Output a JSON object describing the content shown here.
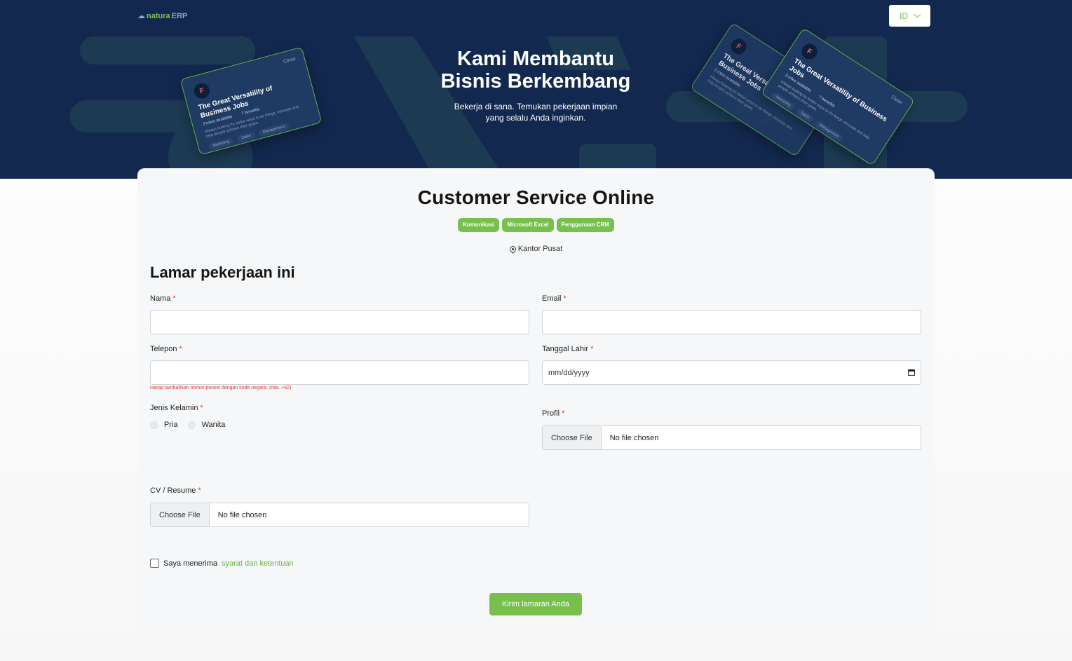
{
  "header": {
    "logo_brand": "natura",
    "logo_suffix": "ERP",
    "language": "ID",
    "title_line1": "Kami Membantu",
    "title_line2": "Bisnis Berkembang",
    "subtitle": "Bekerja di sana. Temukan pekerjaan impian yang selalu Anda inginkan."
  },
  "deco_card": {
    "close": "Close",
    "title": "The Great Versatility of Business Jobs",
    "roles": "3 roles available",
    "benefits": "7 benefits",
    "desc": "Always looking for better ways to do things, innovate and help people achieve their goals.",
    "tags": [
      "Marketing",
      "Sales",
      "Management"
    ]
  },
  "job": {
    "title": "Customer Service Online",
    "tags": [
      "Komunikasi",
      "Microsoft Excel",
      "Penggunaan CRM"
    ],
    "location": "Kantor Pusat"
  },
  "form": {
    "heading": "Lamar pekerjaan ini",
    "required_mark": "*",
    "name_label": "Nama",
    "name_value": "",
    "email_label": "Email",
    "email_value": "",
    "phone_label": "Telepon",
    "phone_value": "",
    "phone_hint": "Harap tambahkan nomor ponsel dengan kode negara. (mis. +62)",
    "birthdate_label": "Tanggal Lahir",
    "birthdate_placeholder": "mm/dd/yyyy",
    "gender_label": "Jenis Kelamin",
    "gender_options": [
      "Pria",
      "Wanita"
    ],
    "profile_label": "Profil",
    "cv_label": "CV / Resume",
    "file_button": "Choose File",
    "file_status": "No file chosen",
    "terms_prefix": "Saya menerima",
    "terms_link": "syarat dan ketentuan",
    "submit": "Kirim lamaran Anda"
  },
  "colors": {
    "hero_bg": "#13284f",
    "accent_green": "#76c04b",
    "required_red": "#e53935"
  }
}
